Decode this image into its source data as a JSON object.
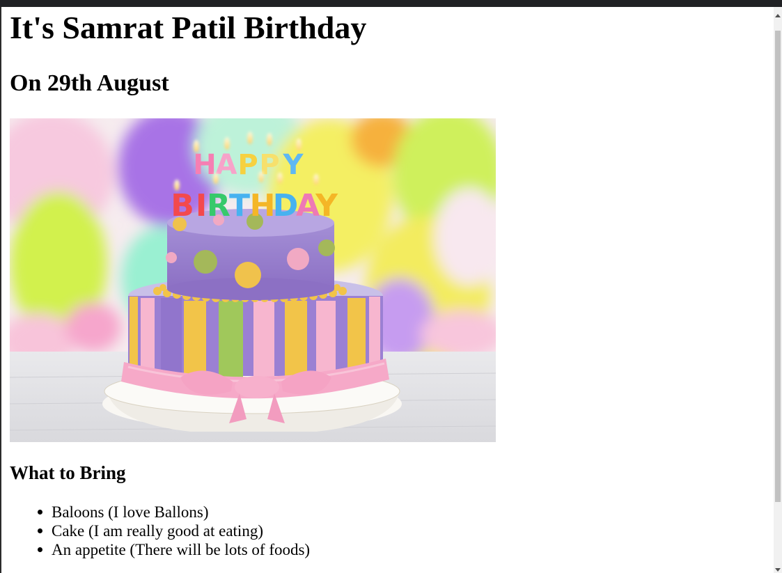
{
  "page": {
    "title": "It's Samrat Patil Birthday",
    "subtitle": "On 29th August"
  },
  "image": {
    "kind": "birthday-cake-photo",
    "cake_topper_line1": "HAPPY",
    "cake_topper_line2": "BIRTHDAY"
  },
  "bring": {
    "heading": "What to Bring",
    "items": [
      "Baloons (I love Ballons)",
      "Cake (I am really good at eating)",
      "An appetite (There will be lots of foods)"
    ]
  },
  "colors": {
    "balloon_purple": "#a86be0",
    "balloon_lime": "#c7ef3f",
    "cake_purple": "#9a7fd0",
    "cake_pink": "#f4a9c8",
    "cake_yellow": "#f2c449",
    "cake_green": "#9dc85a"
  }
}
